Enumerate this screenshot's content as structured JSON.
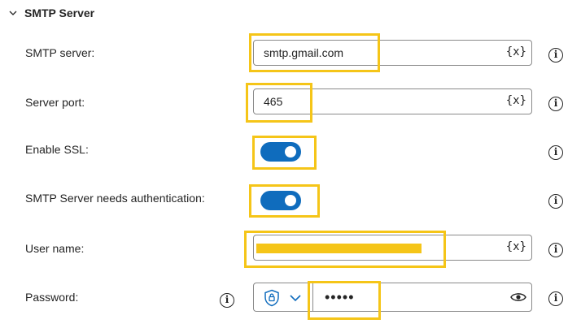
{
  "section": {
    "title": "SMTP Server"
  },
  "fields": {
    "smtp_server": {
      "label": "SMTP server:",
      "value": "smtp.gmail.com",
      "var_button": "{x}"
    },
    "server_port": {
      "label": "Server port:",
      "value": "465",
      "var_button": "{x}"
    },
    "enable_ssl": {
      "label": "Enable SSL:",
      "on": true
    },
    "needs_auth": {
      "label": "SMTP Server needs authentication:",
      "on": true
    },
    "user_name": {
      "label": "User name:",
      "var_button": "{x}"
    },
    "password": {
      "label": "Password:",
      "masked_value": "•••••"
    }
  },
  "icons": {
    "info": "i",
    "section_collapse": "chevron-down-icon",
    "shield": "shield-lock-icon",
    "eye": "eye-icon"
  },
  "colors": {
    "accent": "#0f6cbd",
    "highlight": "#f5c518",
    "border": "#8a8a8a"
  }
}
